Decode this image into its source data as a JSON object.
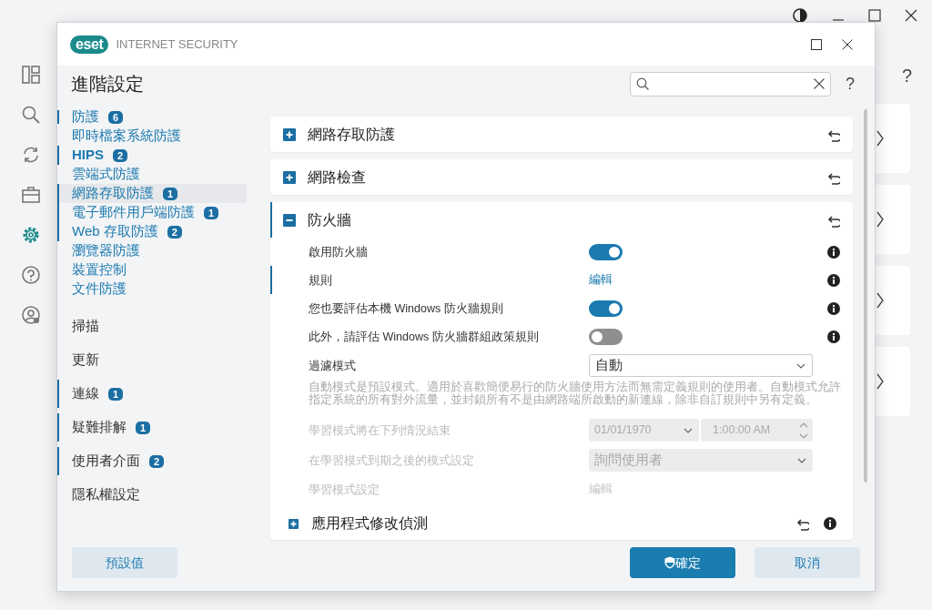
{
  "dialog": {
    "logo": "eset",
    "product": "INTERNET SECURITY",
    "title": "進階設定",
    "help": "?"
  },
  "background": {
    "help": "?"
  },
  "nav": [
    {
      "label": "防護",
      "badge": "6",
      "marked": true,
      "selected": false,
      "children": [
        {
          "label": "即時檔案系統防護",
          "marked": false,
          "selected": false
        },
        {
          "label": "HIPS",
          "badge": "2",
          "marked": true,
          "selected": false
        },
        {
          "label": "雲端式防護",
          "marked": false,
          "selected": false
        },
        {
          "label": "網路存取防護",
          "badge": "1",
          "marked": true,
          "selected": true
        },
        {
          "label": "電子郵件用戶端防護",
          "badge": "1",
          "marked": true,
          "selected": false
        },
        {
          "label": "Web 存取防護",
          "badge": "2",
          "marked": true,
          "selected": false
        },
        {
          "label": "瀏覽器防護",
          "marked": false,
          "selected": false
        },
        {
          "label": "裝置控制",
          "marked": false,
          "selected": false
        },
        {
          "label": "文件防護",
          "marked": false,
          "selected": false
        }
      ]
    },
    {
      "label": "掃描",
      "marked": false,
      "selected": false
    },
    {
      "label": "更新",
      "marked": false,
      "selected": false
    },
    {
      "label": "連線",
      "badge": "1",
      "marked": true,
      "selected": false
    },
    {
      "label": "疑難排解",
      "badge": "1",
      "marked": true,
      "selected": false
    },
    {
      "label": "使用者介面",
      "badge": "2",
      "marked": true,
      "selected": false
    },
    {
      "label": "隱私權設定",
      "marked": false,
      "selected": false
    }
  ],
  "sections": [
    {
      "title": "網路存取防護",
      "expanded": false,
      "marked": false
    },
    {
      "title": "網路檢查",
      "expanded": false,
      "marked": false
    },
    {
      "title": "防火牆",
      "expanded": true,
      "marked": true,
      "rows": [
        {
          "kind": "toggle",
          "label": "啟用防火牆",
          "on": true,
          "info": true,
          "marked": false,
          "disabled": false
        },
        {
          "kind": "link",
          "label": "規則",
          "value": "編輯",
          "info": true,
          "marked": true,
          "disabled": false
        },
        {
          "kind": "toggle",
          "label": "您也要評估本機 Windows 防火牆規則",
          "on": true,
          "info": true,
          "marked": false,
          "disabled": false
        },
        {
          "kind": "toggle",
          "label": "此外，請評估 Windows 防火牆群組政策規則",
          "on": false,
          "info": true,
          "marked": false,
          "disabled": false
        },
        {
          "kind": "select",
          "label": "過濾模式",
          "value": "自動",
          "info": false,
          "marked": false,
          "disabled": false
        },
        {
          "kind": "description",
          "text": "自動模式是預設模式。適用於喜歡簡便易行的防火牆使用方法而無需定義規則的使用者。自動模式允許指定系統的所有對外流量，並封鎖所有不是由網路端所啟動的新連線，除非自訂規則中另有定義。"
        },
        {
          "kind": "datetime",
          "label": "學習模式將在下列情況結束",
          "date": "01/01/1970",
          "time": "1:00:00 AM",
          "info": false,
          "marked": false,
          "disabled": true
        },
        {
          "kind": "select",
          "label": "在學習模式到期之後的模式設定",
          "value": "詢問使用者",
          "info": false,
          "marked": false,
          "disabled": true
        },
        {
          "kind": "link",
          "label": "學習模式設定",
          "value": "編輯",
          "info": false,
          "marked": false,
          "disabled": true
        }
      ],
      "subsections": [
        {
          "title": "應用程式修改偵測",
          "expanded": false
        }
      ]
    }
  ],
  "buttons": [
    {
      "label": "預設值",
      "kind": "secondary"
    },
    {
      "label": "確定",
      "kind": "primary"
    },
    {
      "label": "取消",
      "kind": "secondary"
    }
  ]
}
